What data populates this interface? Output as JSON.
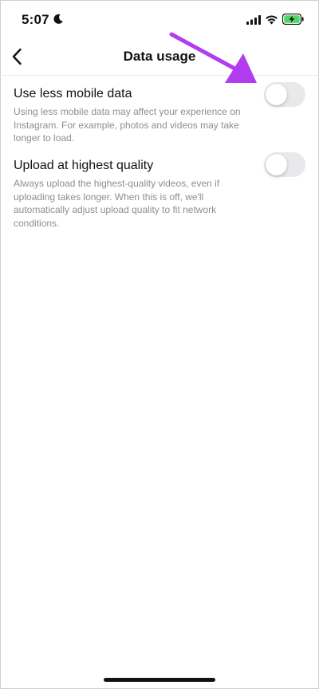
{
  "status_bar": {
    "time": "5:07",
    "icons": [
      "moon-icon",
      "cellular-signal-icon",
      "wifi-icon",
      "battery-charging-icon"
    ],
    "battery_color": "#4cd964"
  },
  "header": {
    "title": "Data usage",
    "back_icon": "chevron-left-icon"
  },
  "settings": [
    {
      "title": "Use less mobile data",
      "description": "Using less mobile data may affect your experience on Instagram. For example, photos and videos may take longer to load.",
      "enabled": false
    },
    {
      "title": "Upload at highest quality",
      "description": "Always upload the highest-quality videos, even if uploading takes longer. When this is off, we'll automatically adjust upload quality to fit network conditions.",
      "enabled": false
    }
  ],
  "annotation": {
    "type": "arrow",
    "color": "#b13cf0"
  }
}
